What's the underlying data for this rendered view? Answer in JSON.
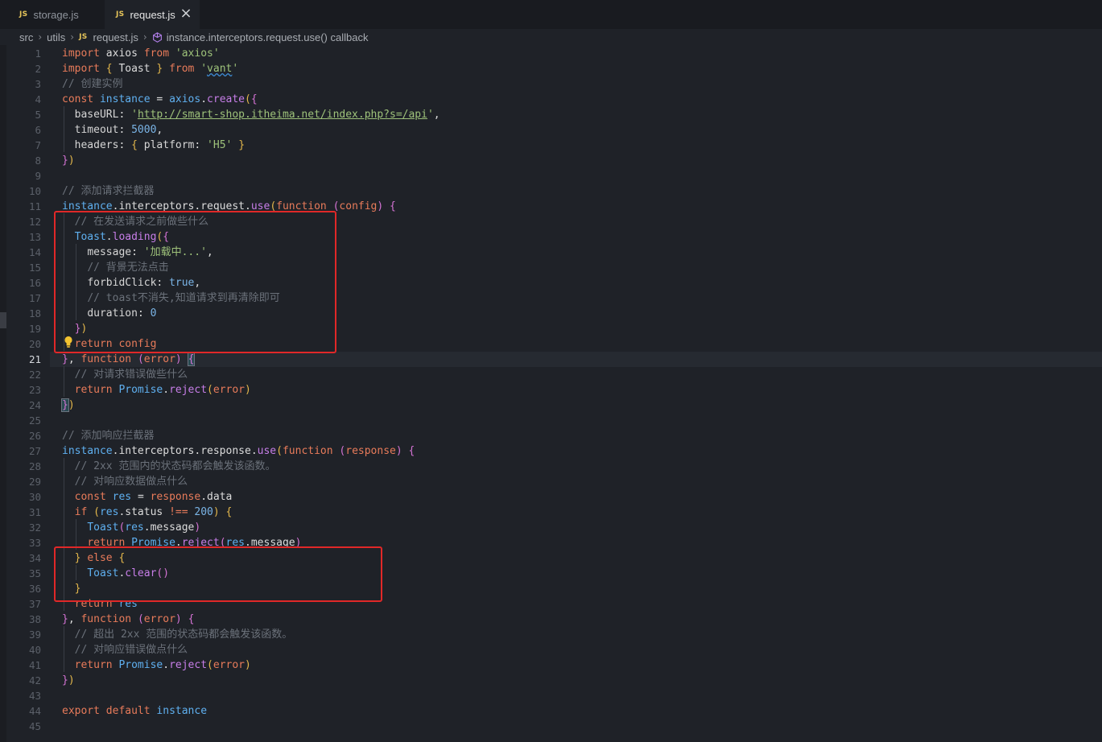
{
  "tabs": [
    {
      "label": "storage.js",
      "icon": "js-file-icon",
      "active": false
    },
    {
      "label": "request.js",
      "icon": "js-file-icon",
      "active": true
    }
  ],
  "js_badge": "JS",
  "close_glyph": "×",
  "breadcrumb": {
    "parts": [
      "src",
      "utils",
      "request.js",
      "instance.interceptors.request.use() callback"
    ],
    "separator": "›"
  },
  "editor": {
    "active_line": 21,
    "lines": [
      {
        "n": "1",
        "html": "<span class='k'>import</span> <span class='p'>axios</span> <span class='k'>from</span> <span class='s'>'axios'</span>"
      },
      {
        "n": "2",
        "html": "<span class='k'>import</span> <span class='br'>{</span> <span class='p'>Toast</span> <span class='br'>}</span> <span class='k'>from</span> <span class='s'>'<span class='wavy'>vant</span>'</span>"
      },
      {
        "n": "3",
        "html": "<span class='c'>// 创建实例</span>"
      },
      {
        "n": "4",
        "html": "<span class='k'>const</span> <span class='v'>instance</span> <span class='p'>=</span> <span class='v'>axios</span><span class='p'>.</span><span class='fn'>create</span><span class='br'>(</span><span class='br2'>{</span>"
      },
      {
        "n": "5",
        "html": "  <span class='pr'>baseURL</span><span class='p'>:</span> <span class='s'>'<span class='url'>http://smart-shop.itheima.net/index.php?s=/api</span>'</span><span class='p'>,</span>"
      },
      {
        "n": "6",
        "html": "  <span class='pr'>timeout</span><span class='p'>:</span> <span class='n'>5000</span><span class='p'>,</span>"
      },
      {
        "n": "7",
        "html": "  <span class='pr'>headers</span><span class='p'>:</span> <span class='br'>{</span> <span class='pr'>platform</span><span class='p'>:</span> <span class='s'>'H5'</span> <span class='br'>}</span>"
      },
      {
        "n": "8",
        "html": "<span class='br2'>}</span><span class='br'>)</span>"
      },
      {
        "n": "9",
        "html": ""
      },
      {
        "n": "10",
        "html": "<span class='c'>// 添加请求拦截器</span>"
      },
      {
        "n": "11",
        "html": "<span class='v'>instance</span><span class='p'>.</span><span class='p'>interceptors</span><span class='p'>.</span><span class='p'>request</span><span class='p'>.</span><span class='fn'>use</span><span class='br'>(</span><span class='k'>function</span> <span class='br2'>(</span><span class='k'>config</span><span class='br2'>)</span> <span class='br2'>{</span>"
      },
      {
        "n": "12",
        "html": "  <span class='c'>// 在发送请求之前做些什么</span>"
      },
      {
        "n": "13",
        "html": "  <span class='v'>Toast</span><span class='p'>.</span><span class='fn'>loading</span><span class='br'>(</span><span class='br2'>{</span>"
      },
      {
        "n": "14",
        "html": "    <span class='pr'>message</span><span class='p'>:</span> <span class='s'>'加载中...'</span><span class='p'>,</span>"
      },
      {
        "n": "15",
        "html": "    <span class='c'>// 背景无法点击</span>"
      },
      {
        "n": "16",
        "html": "    <span class='pr'>forbidClick</span><span class='p'>:</span> <span class='n'>true</span><span class='p'>,</span>"
      },
      {
        "n": "17",
        "html": "    <span class='c'>// toast不消失,知道请求到再清除即可</span>"
      },
      {
        "n": "18",
        "html": "    <span class='pr'>duration</span><span class='p'>:</span> <span class='n'>0</span>"
      },
      {
        "n": "19",
        "html": "  <span class='br2'>}</span><span class='br'>)</span>"
      },
      {
        "n": "20",
        "html": "  <span class='k'>return</span> <span class='k'>config</span>"
      },
      {
        "n": "21",
        "html": "<span class='br2'>}</span><span class='p'>,</span> <span class='k'>function</span> <span class='br2'>(</span><span class='k'>error</span><span class='br2'>)</span> <span class='br2 bracket-match'>{</span>"
      },
      {
        "n": "22",
        "html": "  <span class='c'>// 对请求错误做些什么</span>"
      },
      {
        "n": "23",
        "html": "  <span class='k'>return</span> <span class='v'>Promise</span><span class='p'>.</span><span class='fn'>reject</span><span class='br'>(</span><span class='k'>error</span><span class='br'>)</span>"
      },
      {
        "n": "24",
        "html": "<span class='br2 bracket-match'>}</span><span class='br'>)</span>"
      },
      {
        "n": "25",
        "html": ""
      },
      {
        "n": "26",
        "html": "<span class='c'>// 添加响应拦截器</span>"
      },
      {
        "n": "27",
        "html": "<span class='v'>instance</span><span class='p'>.</span><span class='p'>interceptors</span><span class='p'>.</span><span class='p'>response</span><span class='p'>.</span><span class='fn'>use</span><span class='br'>(</span><span class='k'>function</span> <span class='br2'>(</span><span class='k'>response</span><span class='br2'>)</span> <span class='br2'>{</span>"
      },
      {
        "n": "28",
        "html": "  <span class='c'>// 2xx 范围内的状态码都会触发该函数。</span>"
      },
      {
        "n": "29",
        "html": "  <span class='c'>// 对响应数据做点什么</span>"
      },
      {
        "n": "30",
        "html": "  <span class='k'>const</span> <span class='v'>res</span> <span class='p'>=</span> <span class='k'>response</span><span class='p'>.</span><span class='p'>data</span>"
      },
      {
        "n": "31",
        "html": "  <span class='k'>if</span> <span class='br'>(</span><span class='v'>res</span><span class='p'>.</span><span class='p'>status</span> <span class='k'>!==</span> <span class='n'>200</span><span class='br'>)</span> <span class='br'>{</span>"
      },
      {
        "n": "32",
        "html": "    <span class='v'>Toast</span><span class='br2'>(</span><span class='v'>res</span><span class='p'>.</span><span class='p'>message</span><span class='br2'>)</span>"
      },
      {
        "n": "33",
        "html": "    <span class='k'>return</span> <span class='v'>Promise</span><span class='p'>.</span><span class='fn'>reject</span><span class='br2'>(</span><span class='v'>res</span><span class='p'>.</span><span class='p'>message</span><span class='br2'>)</span>"
      },
      {
        "n": "34",
        "html": "  <span class='br'>}</span> <span class='k'>else</span> <span class='br'>{</span>"
      },
      {
        "n": "35",
        "html": "    <span class='v'>Toast</span><span class='p'>.</span><span class='fn'>clear</span><span class='br2'>()</span>"
      },
      {
        "n": "36",
        "html": "  <span class='br'>}</span>"
      },
      {
        "n": "37",
        "html": "  <span class='k'>return</span> <span class='v'>res</span>"
      },
      {
        "n": "38",
        "html": "<span class='br2'>}</span><span class='p'>,</span> <span class='k'>function</span> <span class='br2'>(</span><span class='k'>error</span><span class='br2'>)</span> <span class='br2'>{</span>"
      },
      {
        "n": "39",
        "html": "  <span class='c'>// 超出 2xx 范围的状态码都会触发该函数。</span>"
      },
      {
        "n": "40",
        "html": "  <span class='c'>// 对响应错误做点什么</span>"
      },
      {
        "n": "41",
        "html": "  <span class='k'>return</span> <span class='v'>Promise</span><span class='p'>.</span><span class='fn'>reject</span><span class='br'>(</span><span class='k'>error</span><span class='br'>)</span>"
      },
      {
        "n": "42",
        "html": "<span class='br2'>}</span><span class='br'>)</span>"
      },
      {
        "n": "43",
        "html": ""
      },
      {
        "n": "44",
        "html": "<span class='k'>export</span> <span class='k'>default</span> <span class='v'>instance</span>"
      },
      {
        "n": "45",
        "html": ""
      }
    ]
  },
  "annotations": [
    {
      "name": "red-box-request-loading"
    },
    {
      "name": "red-box-else-clear"
    }
  ]
}
